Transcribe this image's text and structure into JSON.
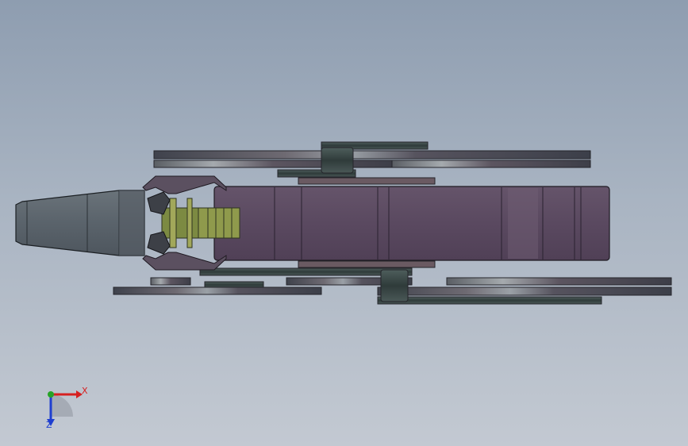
{
  "viewport": {
    "background_top": "#8e9db0",
    "background_bottom": "#c3c9d2"
  },
  "model": {
    "body_color": "#5b4a60",
    "body_highlight": "#705d74",
    "nozzle_color": "#5d666e",
    "gripper_color": "#7c8a42",
    "bar_dark": "#3f424c",
    "bar_light": "#8a8f94",
    "roller_color": "#3a4a48"
  },
  "triad": {
    "x_label": "X",
    "z_label": "Z",
    "x_color": "#d62020",
    "y_color": "#27a327",
    "z_color": "#1f3fd0"
  }
}
